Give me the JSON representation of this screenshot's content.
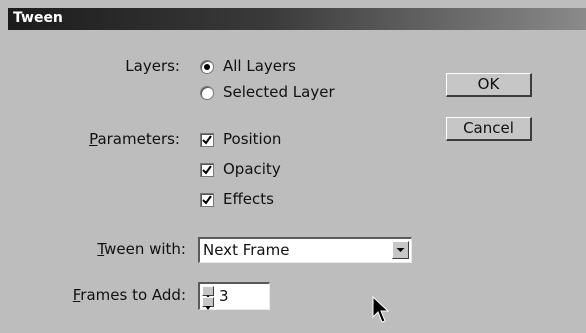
{
  "window": {
    "title": "Tween"
  },
  "layers": {
    "label": "Layers:",
    "options": [
      {
        "label": "All Layers",
        "selected": true
      },
      {
        "label": "Selected Layer",
        "selected": false
      }
    ]
  },
  "parameters": {
    "label_prefix": "P",
    "label_rest": "arameters:",
    "options": [
      {
        "label": "Position",
        "checked": true
      },
      {
        "label": "Opacity",
        "checked": true
      },
      {
        "label": "Effects",
        "checked": true
      }
    ]
  },
  "tween_with": {
    "label_prefix": "T",
    "label_rest": "ween with:",
    "value": "Next Frame",
    "arrow_icon": "chevron-down-icon"
  },
  "frames_to_add": {
    "label_prefix": "F",
    "label_rest": "rames to Add:",
    "value": "3"
  },
  "buttons": {
    "ok": "OK",
    "cancel": "Cancel"
  },
  "colors": {
    "dialog_bg": "#bdbdbd",
    "titlebar_dark": "#1c1c1c",
    "titlebar_light": "#8a8a8a"
  }
}
